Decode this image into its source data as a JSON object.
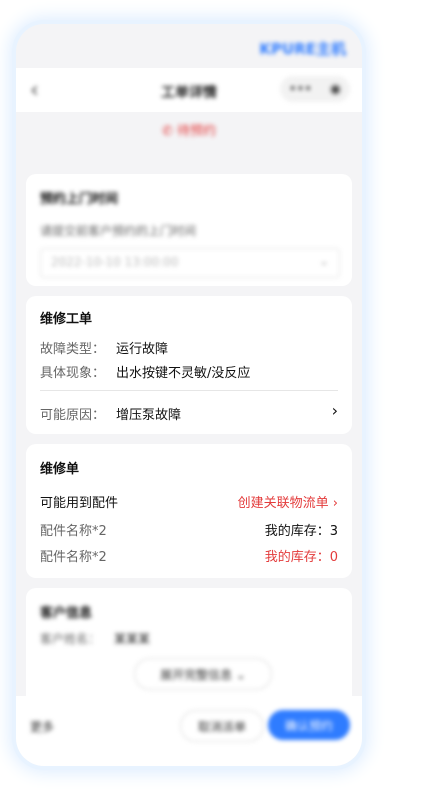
{
  "brand": "KPURE主机",
  "nav": {
    "title": "工单详情",
    "more_glyph": "•••",
    "close_glyph": "◉",
    "back_glyph": "‹"
  },
  "status_text": "待预约",
  "appointment": {
    "title": "预约上门时间",
    "hint": "请提交前客户预约的上门时间",
    "placeholder": "2022-10-10 13:00:00"
  },
  "repair_order": {
    "title": "维修工单",
    "fault_type_label": "故障类型：",
    "fault_type_value": "运行故障",
    "symptom_label": "具体现象：",
    "symptom_value": "出水按键不灵敏/没反应",
    "cause_label": "可能原因：",
    "cause_value": "增压泵故障"
  },
  "repair_list": {
    "title": "维修单",
    "parts_label": "可能用到配件",
    "create_link": "创建关联物流单 ›",
    "items": [
      {
        "name": "配件名称*2",
        "stock": "我的库存：3",
        "low": false
      },
      {
        "name": "配件名称*2",
        "stock": "我的库存：0",
        "low": true
      }
    ]
  },
  "customer": {
    "title": "客户信息",
    "name_label": "客户姓名：",
    "name_value": "某某某",
    "expand_label": "展开完整信息 ⌄"
  },
  "bottom": {
    "more": "更多",
    "cancel": "取消派单",
    "confirm": "确认预约"
  },
  "colors": {
    "accent": "#2f7cff",
    "danger": "#e33b3b"
  }
}
